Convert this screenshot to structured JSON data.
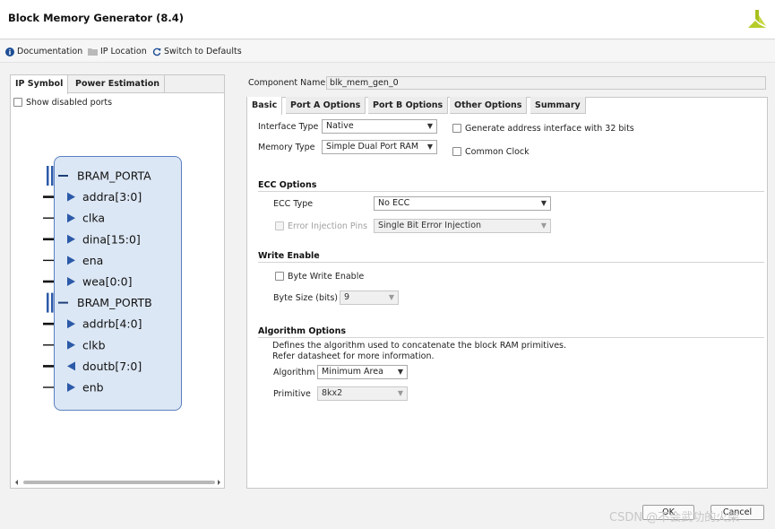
{
  "window": {
    "title": "Block Memory Generator (8.4)"
  },
  "toolbar": {
    "documentation": "Documentation",
    "ip_location": "IP Location",
    "switch_defaults": "Switch to Defaults"
  },
  "left_panel": {
    "tabs": [
      "IP Symbol",
      "Power Estimation"
    ],
    "show_disabled_ports": "Show disabled ports",
    "symbol": {
      "port_a": {
        "name": "BRAM_PORTA",
        "pins": [
          {
            "name": "addra[3:0]",
            "dir": "in",
            "bus": true
          },
          {
            "name": "clka",
            "dir": "in",
            "bus": false
          },
          {
            "name": "dina[15:0]",
            "dir": "in",
            "bus": true
          },
          {
            "name": "ena",
            "dir": "in",
            "bus": false
          },
          {
            "name": "wea[0:0]",
            "dir": "in",
            "bus": true
          }
        ]
      },
      "port_b": {
        "name": "BRAM_PORTB",
        "pins": [
          {
            "name": "addrb[4:0]",
            "dir": "in",
            "bus": true
          },
          {
            "name": "clkb",
            "dir": "in",
            "bus": false
          },
          {
            "name": "doutb[7:0]",
            "dir": "out",
            "bus": true
          },
          {
            "name": "enb",
            "dir": "in",
            "bus": false
          }
        ]
      }
    }
  },
  "component": {
    "label": "Component Name",
    "value": "blk_mem_gen_0"
  },
  "tabs": [
    "Basic",
    "Port A Options",
    "Port B Options",
    "Other Options",
    "Summary"
  ],
  "basic": {
    "interface_type": {
      "label": "Interface Type",
      "value": "Native"
    },
    "memory_type": {
      "label": "Memory Type",
      "value": "Simple Dual Port RAM"
    },
    "gen_addr_32": "Generate address interface with 32 bits",
    "common_clock": "Common Clock",
    "ecc": {
      "title": "ECC Options",
      "type_label": "ECC Type",
      "type_value": "No ECC",
      "injection_label": "Error Injection Pins",
      "injection_value": "Single Bit Error Injection"
    },
    "write_enable": {
      "title": "Write Enable",
      "byte_write": "Byte Write Enable",
      "byte_size_label": "Byte Size (bits)",
      "byte_size_value": "9"
    },
    "algorithm": {
      "title": "Algorithm Options",
      "desc_line1": "Defines the algorithm used to concatenate the block RAM primitives.",
      "desc_line2": "Refer datasheet for more information.",
      "algorithm_label": "Algorithm",
      "algorithm_value": "Minimum Area",
      "primitive_label": "Primitive",
      "primitive_value": "8kx2"
    }
  },
  "buttons": {
    "ok": "OK",
    "cancel": "Cancel"
  },
  "watermark": "CSDN @不会武功的火柴",
  "colors": {
    "block_fill": "#dce7f5",
    "block_border": "#5b7fc0",
    "arrow": "#2c5aa8"
  }
}
